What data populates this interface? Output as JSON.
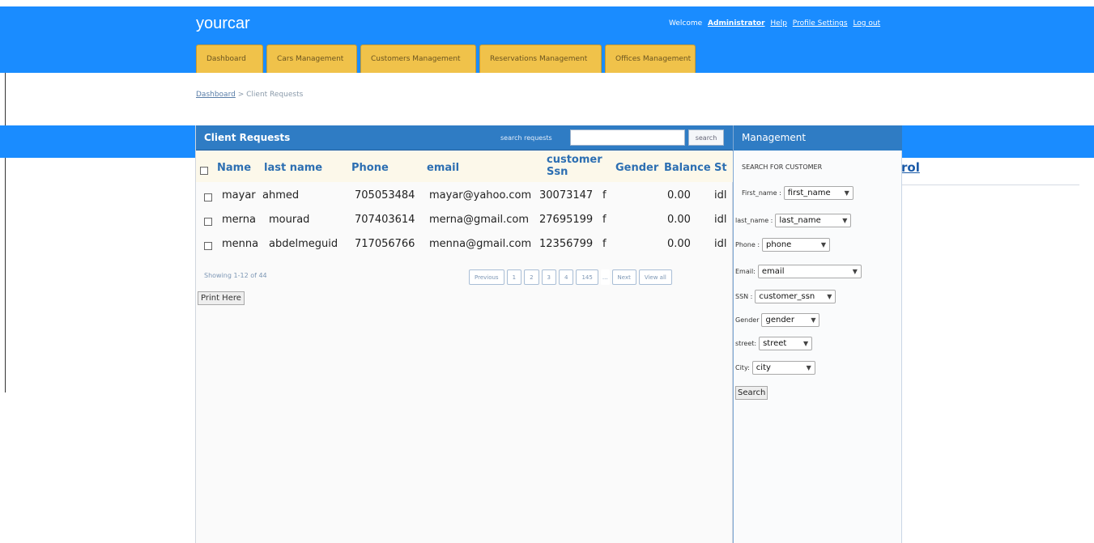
{
  "app": {
    "brand": "yourcar"
  },
  "userbar": {
    "welcome": "Welcome",
    "user": "Administrator",
    "help": "Help",
    "profile": "Profile Settings",
    "logout": "Log out"
  },
  "nav": {
    "tabs": [
      "Dashboard",
      "Cars Management",
      "Customers Management",
      "Reservations Management",
      "Offices Management"
    ]
  },
  "breadcrumb": {
    "home": "Dashboard",
    "sep": ">",
    "current": "Client Requests"
  },
  "peek": {
    "text": "rol"
  },
  "requests": {
    "title": "Client Requests",
    "search_label": "search requests",
    "search_value": "",
    "search_button": "search",
    "columns": [
      "Name",
      "last name",
      "Phone",
      "email",
      "customer Ssn",
      "Gender",
      "Balance",
      "St"
    ],
    "rows": [
      {
        "name": "mayar",
        "last": "ahmed",
        "phone": "705053484",
        "email": "mayar@yahoo.com",
        "ssn": "30073147",
        "gender": "f",
        "balance": "0.00",
        "status": "idl"
      },
      {
        "name": "merna",
        "last": "mourad",
        "phone": "707403614",
        "email": "merna@gmail.com",
        "ssn": "27695199",
        "gender": "f",
        "balance": "0.00",
        "status": "idl"
      },
      {
        "name": "menna",
        "last": "abdelmeguid",
        "phone": "717056766",
        "email": "menna@gmail.com",
        "ssn": "12356799",
        "gender": "f",
        "balance": "0.00",
        "status": "idl"
      }
    ],
    "showing": "Showing 1-12 of 44",
    "pager": {
      "prev": "Previous",
      "pages": [
        "1",
        "2",
        "3",
        "4",
        "145"
      ],
      "dots": "...",
      "next": "Next",
      "view_all": "View all"
    },
    "print_button": "Print Here"
  },
  "management": {
    "title": "Management",
    "subtitle": "SEARCH FOR CUSTOMER",
    "fields": [
      {
        "label": "First_name :",
        "value": "first_name"
      },
      {
        "label": "last_name :",
        "value": "last_name"
      },
      {
        "label": "Phone :",
        "value": "phone"
      },
      {
        "label": "Email:",
        "value": "email"
      },
      {
        "label": "SSN :",
        "value": "customer_ssn"
      },
      {
        "label": "Gender",
        "value": "gender"
      },
      {
        "label": "street:",
        "value": "street"
      },
      {
        "label": "City:",
        "value": "city"
      }
    ],
    "search_button": "Search"
  },
  "colors": {
    "header_blue": "#1a8cff",
    "panel_blue": "#2f7cc4",
    "tab_yellow": "#f0c24a",
    "heading_blue": "#2d6fb2"
  }
}
